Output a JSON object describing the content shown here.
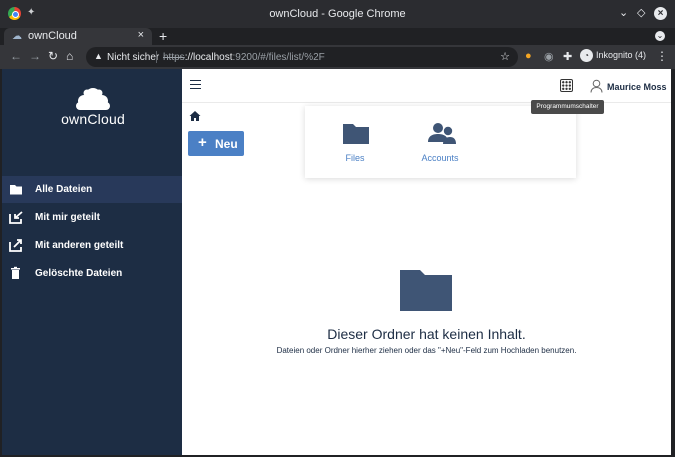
{
  "window": {
    "title": "ownCloud - Google Chrome"
  },
  "tabbar": {
    "tab_title": "ownCloud",
    "new_tab": "+",
    "close": "×"
  },
  "toolbar": {
    "security_label": "Nicht sicher",
    "url_scheme": "https",
    "url_host": "://localhost",
    "url_rest": ":9200/#/files/list/%2F",
    "incognito_label": "Inkognito (4)"
  },
  "brand": {
    "wordmark": "ownCloud"
  },
  "sidebar": {
    "items": [
      {
        "label": "Alle Dateien",
        "icon": "folder-icon",
        "active": true
      },
      {
        "label": "Mit mir geteilt",
        "icon": "share-in-icon",
        "active": false
      },
      {
        "label": "Mit anderen geteilt",
        "icon": "share-out-icon",
        "active": false
      },
      {
        "label": "Gelöschte Dateien",
        "icon": "trash-icon",
        "active": false
      }
    ]
  },
  "header": {
    "user_name": "Maurice Moss",
    "app_switcher_tooltip": "Programmumschalter"
  },
  "actions": {
    "new_button": "Neu",
    "new_plus": "+"
  },
  "app_switcher_menu": {
    "apps": [
      {
        "label": "Files",
        "icon": "folder-icon"
      },
      {
        "label": "Accounts",
        "icon": "users-icon"
      }
    ]
  },
  "empty_state": {
    "title": "Dieser Ordner hat keinen Inhalt.",
    "hint": "Dateien oder Ordner hierher ziehen oder das \"+Neu\"-Feld zum Hochladen benutzen."
  },
  "colors": {
    "sidebar_bg": "#1d2d44",
    "accent": "#4b80c5",
    "active_item": "#28395a"
  }
}
